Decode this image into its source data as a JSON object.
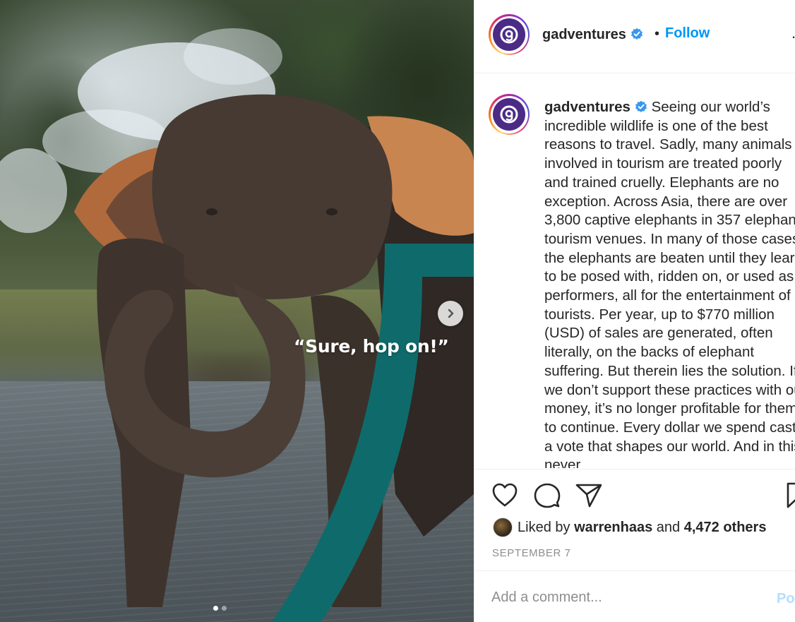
{
  "photo": {
    "overlay_quote": "“Sure, hop on!”",
    "next_icon": "chevron-right-icon",
    "carousel_slides": 2,
    "carousel_active_index": 0
  },
  "post_header": {
    "username": "gadventures",
    "verified_icon": "verified-badge-icon",
    "separator": "•",
    "follow_label": "Follow",
    "more_icon": "more-options-icon",
    "more_text": "…"
  },
  "caption": {
    "username": "gadventures",
    "text": "Seeing our world’s incredible wildlife is one of the best reasons to travel. Sadly, many animals involved in tourism are treated poorly and trained cruelly. Elephants are no exception. Across Asia, there are over 3,800 captive elephants in 357 elephant tourism venues. In many of those cases, the elephants are beaten until they learn to be posed with, ridden on, or used as performers, all for the entertainment of tourists. Per year, up to $770 million (USD) of sales are generated, often literally, on the backs of elephant suffering. But therein lies the solution. If we don’t support these practices with our money, it’s no longer profitable for them to continue. Every dollar we spend casts a vote that shapes our world. And in this never"
  },
  "actions": {
    "like_icon": "heart-icon",
    "comment_icon": "comment-icon",
    "share_icon": "share-icon",
    "save_icon": "bookmark-icon"
  },
  "likes": {
    "prefix": "Liked by",
    "user": "warrenhaas",
    "conjunction": "and",
    "others": "4,472 others"
  },
  "date": "SEPTEMBER 7",
  "comment": {
    "placeholder": "Add a comment...",
    "post_label": "Post"
  },
  "colors": {
    "accent_blue": "#0095f6",
    "post_disabled": "#b2dffc",
    "brand_purple": "#4b2b86",
    "brand_teal": "#0f6b6b"
  }
}
